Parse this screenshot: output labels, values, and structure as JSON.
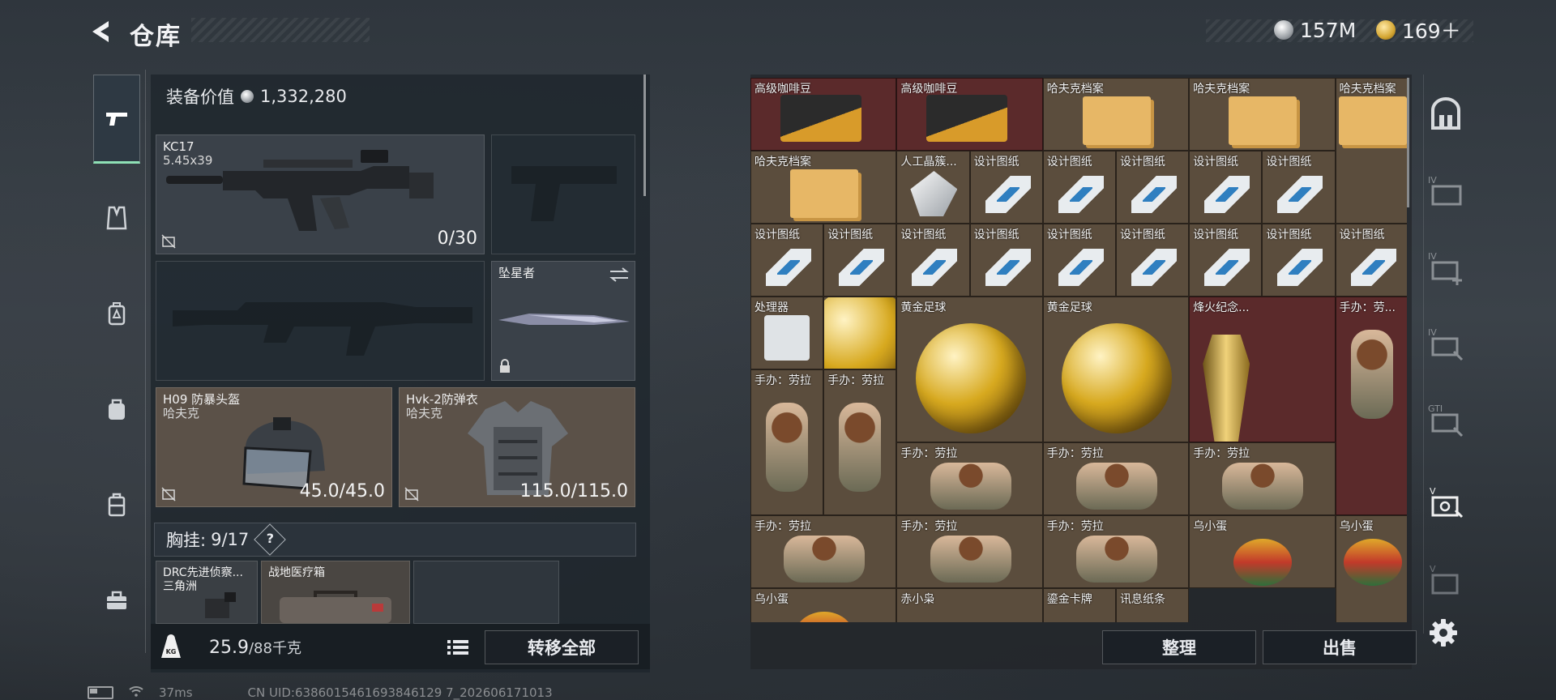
{
  "header": {
    "title": "仓库"
  },
  "currency": [
    {
      "icon": "silver-coin-icon",
      "value": "157M"
    },
    {
      "icon": "gold-coin-icon",
      "value": "169＋"
    }
  ],
  "left_rail": [
    "pistol-icon",
    "vest-icon",
    "backpack-icon",
    "bag-icon",
    "case-icon",
    "toolbox-icon"
  ],
  "loadout": {
    "value_label": "装备价值",
    "value": "1,332,280",
    "primary": {
      "name": "KC17",
      "ammo": "5.45x39",
      "count": "0/30"
    },
    "melee": {
      "name": "坠星者"
    },
    "helmet": {
      "name": "H09 防暴头盔",
      "brand": "哈夫克",
      "durability": "45.0/45.0"
    },
    "armor": {
      "name": "Hvk-2防弹衣",
      "brand": "哈夫克",
      "durability": "115.0/115.0"
    },
    "chest": {
      "label": "胸挂:",
      "count": "9/17",
      "help": "?"
    },
    "chest_items": [
      {
        "name": "DRC先进侦察...",
        "sub": "三角洲"
      },
      {
        "name": "战地医疗箱",
        "sub": ""
      }
    ],
    "weight": {
      "current": "25.9",
      "max": "/88千克"
    },
    "transfer_label": "转移全部"
  },
  "inventory": {
    "items": [
      {
        "label": "高级咖啡豆",
        "color": "red"
      },
      {
        "label": "高级咖啡豆",
        "color": "red"
      },
      {
        "label": "哈夫克档案",
        "color": "brn"
      },
      {
        "label": "哈夫克档案",
        "color": "brn"
      },
      {
        "label": "哈夫克档案",
        "color": "brn"
      },
      {
        "label": "哈夫克档案",
        "color": "brn"
      },
      {
        "label": "人工晶簇...",
        "color": "brn"
      },
      {
        "label": "设计图纸",
        "color": "brn"
      },
      {
        "label": "设计图纸",
        "color": "brn"
      },
      {
        "label": "设计图纸",
        "color": "brn"
      },
      {
        "label": "设计图纸",
        "color": "brn"
      },
      {
        "label": "设计图纸",
        "color": "brn"
      },
      {
        "label": "设计图纸",
        "color": "brn"
      },
      {
        "label": "设计图纸",
        "color": "brn"
      },
      {
        "label": "设计图纸",
        "color": "brn"
      },
      {
        "label": "设计图纸",
        "color": "brn"
      },
      {
        "label": "设计图纸",
        "color": "brn"
      },
      {
        "label": "设计图纸",
        "color": "brn"
      },
      {
        "label": "设计图纸",
        "color": "brn"
      },
      {
        "label": "设计图纸",
        "color": "brn"
      },
      {
        "label": "设计图纸",
        "color": "brn"
      },
      {
        "label": "处理器",
        "color": "brn"
      },
      {
        "label": "黄金足球",
        "color": "brn"
      },
      {
        "label": "黄金足球",
        "color": "brn"
      },
      {
        "label": "黄金足球",
        "color": "brn"
      },
      {
        "label": "烽火纪念...",
        "color": "red"
      },
      {
        "label": "手办：劳...",
        "color": "red"
      },
      {
        "label": "手办：劳拉",
        "color": "brn"
      },
      {
        "label": "手办：劳拉",
        "color": "brn"
      },
      {
        "label": "手办：劳拉",
        "color": "brn"
      },
      {
        "label": "手办：劳拉",
        "color": "brn"
      },
      {
        "label": "手办：劳拉",
        "color": "brn"
      },
      {
        "label": "手办：劳拉",
        "color": "brn"
      },
      {
        "label": "手办：劳拉",
        "color": "brn"
      },
      {
        "label": "手办：劳拉",
        "color": "brn"
      },
      {
        "label": "乌小蛋",
        "color": "brn"
      },
      {
        "label": "乌小蛋",
        "color": "brn"
      },
      {
        "label": "乌小蛋",
        "color": "brn"
      },
      {
        "label": "赤小枭",
        "color": "brn"
      },
      {
        "label": "鎏金卡牌",
        "color": "brn"
      },
      {
        "label": "讯息纸条",
        "color": "brn"
      }
    ],
    "sort_label": "整理",
    "sell_label": "出售"
  },
  "right_rail": [
    "locker-icon",
    "expand-slot-1-icon",
    "expand-slot-2-icon",
    "expand-slot-3-icon",
    "expand-slot-4-icon",
    "expand-slot-5-icon",
    "expand-slot-6-icon",
    "settings-icon"
  ],
  "status": {
    "ping": "37ms",
    "uid": "CN UID:6386015461693846129 7_202606171013"
  }
}
